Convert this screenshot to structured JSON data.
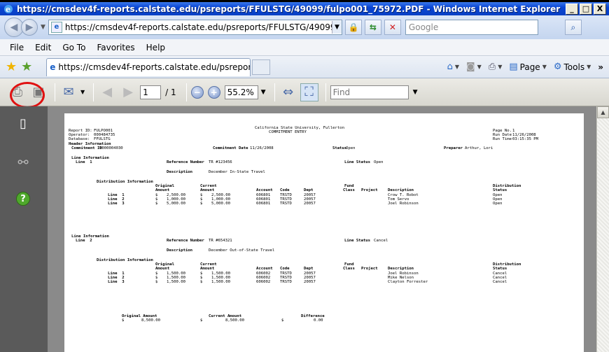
{
  "window": {
    "title": "https://cmsdev4f-reports.calstate.edu/psreports/FFULSTG/49099/fulpo001_75972.PDF - Windows Internet Explorer",
    "min": "_",
    "max": "□",
    "close": "X"
  },
  "address": {
    "url": "https://cmsdev4f-reports.calstate.edu/psreports/FFULSTG/49099/fulpo0C",
    "search_placeholder": "Google"
  },
  "menu": [
    "File",
    "Edit",
    "Go To",
    "Favorites",
    "Help"
  ],
  "tab": {
    "title": "https://cmsdev4f-reports.calstate.edu/psreports/FFU..."
  },
  "commands": {
    "page": "Page",
    "tools": "Tools",
    "more": "»"
  },
  "pdf_toolbar": {
    "page": "1",
    "of": "/ 1",
    "zoom": "55.2%",
    "find_placeholder": "Find"
  },
  "report": {
    "header_left": [
      {
        "k": "Report ID:",
        "v": "FULPO001"
      },
      {
        "k": "Operator:",
        "v": "000484735"
      },
      {
        "k": "Database:",
        "v": "FFULSTG"
      }
    ],
    "title1": "California State University, Fullerton",
    "title2": "COMMITMENT ENTRY",
    "header_right": [
      {
        "k": "Page No.",
        "v": "1"
      },
      {
        "k": "Run Date",
        "v": "11/26/2008"
      },
      {
        "k": "Run Time",
        "v": "03:15:35 PM"
      }
    ],
    "header_info_label": "Header Information",
    "commitment_id_label": "Commitment ID",
    "commitment_id": "0000004030",
    "commitment_date_label": "Commitment Date",
    "commitment_date": "11/26/2008",
    "status_label": "Status",
    "status": "Open",
    "preparer_label": "Preparer",
    "preparer": "Arthur, Lori",
    "line_info_label": "Line Information",
    "ref_label": "Reference Number",
    "line_status_label": "Line Status",
    "desc_label": "Description",
    "dist_info_label": "Distribution Information",
    "col_original": "Original",
    "col_amount": "Amount",
    "col_current": "Current",
    "col_fund": "Fund",
    "col_account": "Account",
    "col_code": "Code",
    "col_dept": "Dept",
    "col_class": "Class",
    "col_project": "Project",
    "col_description": "Description",
    "col_distribution": "Distribution",
    "col_status": "Status",
    "lines": [
      {
        "line": "Line  1",
        "ref": "TR #123456",
        "line_status": "Open",
        "desc": "December In-State Travel",
        "dist": [
          {
            "line": "Line  1",
            "orig": "2,500.00",
            "cur": "2,500.00",
            "acct": "606801",
            "fund": "TRSTD",
            "dept": "20057",
            "desc": "Crow T. Robot",
            "status": "Open"
          },
          {
            "line": "Line  2",
            "orig": "1,000.00",
            "cur": "1,000.00",
            "acct": "606801",
            "fund": "TRSTD",
            "dept": "20057",
            "desc": "Tom Servo",
            "status": "Open"
          },
          {
            "line": "Line  3",
            "orig": "5,000.00",
            "cur": "5,000.00",
            "acct": "606801",
            "fund": "TRSTD",
            "dept": "20057",
            "desc": "Joel Robinson",
            "status": "Open"
          }
        ]
      },
      {
        "line": "Line  2",
        "ref": "TR #654321",
        "line_status": "Cancel",
        "desc": "December Out-of-State Travel",
        "dist": [
          {
            "line": "Line  1",
            "orig": "1,500.00",
            "cur": "1,500.00",
            "acct": "606002",
            "fund": "TRSTD",
            "dept": "20057",
            "desc": "Joel Robinson",
            "status": "Cancel"
          },
          {
            "line": "Line  2",
            "orig": "1,500.00",
            "cur": "1,500.00",
            "acct": "606002",
            "fund": "TRSTD",
            "dept": "20057",
            "desc": "Mike Nelson",
            "status": "Cancel"
          },
          {
            "line": "Line  3",
            "orig": "1,500.00",
            "cur": "1,500.00",
            "acct": "606002",
            "fund": "TRSTD",
            "dept": "20057",
            "desc": "Clayton Forrester",
            "status": "Cancel"
          }
        ]
      }
    ],
    "totals": {
      "orig_label": "Original Amount",
      "orig": "8,500.00",
      "cur_label": "Current Amount",
      "cur": "8,500.00",
      "diff_label": "Difference",
      "diff": "0.00",
      "currency": "$"
    }
  }
}
